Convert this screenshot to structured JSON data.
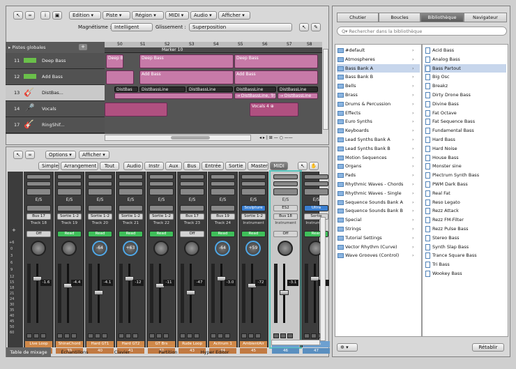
{
  "arrange": {
    "toolbar": {
      "edit": "Edition ▾",
      "track": "Piste ▾",
      "region": "Région ▾",
      "midi": "MIDI ▾",
      "audio": "Audio ▾",
      "view": "Afficher ▾"
    },
    "snap_label": "Magnétisme :",
    "snap_value": "Intelligent",
    "drag_label": "Glissement :",
    "drag_value": "Superposition",
    "global_tracks": "▸ Pistes globales",
    "bars": [
      "50",
      "S1",
      "S2",
      "S3",
      "S4",
      "S5",
      "S6",
      "S7",
      "S8"
    ],
    "marker": "Marker 10",
    "tracks": [
      {
        "num": "11",
        "name": "Deep Bass"
      },
      {
        "num": "12",
        "name": "Add Bass"
      },
      {
        "num": "13",
        "name": "DistBas..."
      },
      {
        "num": "14",
        "name": "Vocals"
      },
      {
        "num": "17",
        "name": "RingShif..."
      }
    ],
    "regions": {
      "deep_a": "Deep B",
      "deep_b": "Deep Bass",
      "deep_c": "Deep Bass",
      "add_b": "Add Bass",
      "add_c": "Add Bass",
      "dist_1": "DistBas",
      "dist_2": "DistBassLine",
      "dist_3": "DistBassLine",
      "dist_4": "DistBassLine",
      "dist_5": "DistBassLine",
      "dist_6": "→ DistBassLine, Tr)",
      "dist_7": "→ DistBassLine",
      "vocals": "Vocals 4 ⊕"
    }
  },
  "mixer": {
    "options": "Options ▾",
    "view": "Afficher ▾",
    "filters": [
      "Simple",
      "Arrangement",
      "Tout",
      "Audio",
      "Instr",
      "Aux",
      "Bus",
      "Entrée",
      "Sortie",
      "Master",
      "MIDI"
    ],
    "scale": [
      "+",
      "+6",
      "0",
      "3",
      "6",
      "9",
      "12",
      "15",
      "18",
      "21",
      "24",
      "30",
      "35",
      "40",
      "45",
      "50",
      "60"
    ],
    "strips": [
      {
        "io": "E/S",
        "slot": "",
        "out": "Bus 17",
        "track": "Track 18",
        "auto": "Off",
        "pan": "",
        "vol": "-1.6",
        "name": "Live Loop",
        "num": "38"
      },
      {
        "io": "E/S",
        "slot": "",
        "out": "Sortie 1-2",
        "track": "Track 19",
        "auto": "Read",
        "pan": "",
        "vol": "-4.4",
        "name": "ShineChord",
        "num": "39"
      },
      {
        "io": "E/S",
        "slot": "",
        "out": "Sortie 1-2",
        "track": "Track 20",
        "auto": "Read",
        "pan": "-64",
        "vol": "-4.1",
        "name": "Hard GT1",
        "num": "40"
      },
      {
        "io": "E/S",
        "slot": "",
        "out": "Sortie 1-2",
        "track": "Track 21",
        "auto": "Read",
        "pan": "+63",
        "vol": "-12",
        "name": "Hard GT2",
        "num": "41"
      },
      {
        "io": "E/S",
        "slot": "",
        "out": "Sortie 1-2",
        "track": "Track 22",
        "auto": "Read",
        "pan": "",
        "vol": "-11",
        "name": "GT Brs",
        "num": "42"
      },
      {
        "io": "E/S",
        "slot": "",
        "out": "Bus 17",
        "track": "Track 23",
        "auto": "Off",
        "pan": "",
        "vol": "-47",
        "name": "Rude Loop",
        "num": "43"
      },
      {
        "io": "E/S",
        "slot": "",
        "out": "Bus 19",
        "track": "Track 24",
        "auto": "Read",
        "pan": "-64",
        "vol": "-3.0",
        "name": "Acitrum 1",
        "num": "44"
      },
      {
        "io": "E/S",
        "slot": "Sculpture",
        "out": "Sortie 1-2",
        "track": "Instrument",
        "auto": "Read",
        "pan": "+59",
        "vol": "-72",
        "name": "AmbientAir",
        "num": "45"
      },
      {
        "io": "E/S",
        "slot": "ES2",
        "out": "Bus 18",
        "track": "Instrument",
        "auto": "Off",
        "pan": "",
        "vol": "-3.1",
        "name": "CrunchBass",
        "num": "46"
      },
      {
        "io": "E/S",
        "slot": "Ultra",
        "out": "Sortie",
        "track": "Instrument",
        "auto": "Read",
        "pan": "",
        "vol": "",
        "name": "Ultra",
        "num": "47"
      }
    ],
    "bottom_tabs": [
      "Table de mixage",
      "Échantillons",
      "Clavier",
      "Partition",
      "Hyper Editor"
    ]
  },
  "browser": {
    "tabs": [
      "Chutier",
      "Boucles",
      "Bibliothèque",
      "Navigateur"
    ],
    "search_placeholder": "Q▾ Rechercher dans la bibliothèque",
    "categories": [
      "#default",
      "Atmospheres",
      "Bass Bank A",
      "Bass Bank B",
      "Bells",
      "Brass",
      "Drums & Percussion",
      "Effects",
      "Euro Synths",
      "Keyboards",
      "Lead Synths Bank A",
      "Lead Synths Bank B",
      "Motion Sequences",
      "Organs",
      "Pads",
      "Rhythmic Waves - Chords",
      "Rhythmic Waves - Single",
      "Sequence Sounds Bank A",
      "Sequence Sounds Bank B",
      "Special",
      "Strings",
      "Tutorial Settings",
      "Vector Rhythm (Curve)",
      "Wave Grooves (Control)"
    ],
    "selected_category": 2,
    "patches": [
      "Acid Bass",
      "Analog Bass",
      "Bass Partout",
      "Big Osc",
      "Breakz",
      "Dirty Drone Bass",
      "Divine Bass",
      "Fat Octave",
      "Fat Sequence Bass",
      "Fundamental Bass",
      "Hard Bass",
      "Hard Noise",
      "House Bass",
      "Monster sine",
      "Plectrum Synth Bass",
      "PWM Dark Bass",
      "Real Fat",
      "Reso Legato",
      "Rezz Attack",
      "Rezz FM-Filter",
      "Rezz Pulse Bass",
      "Stereo Bass",
      "Synth Slap Bass",
      "Trance Square Bass",
      "Tri Bass",
      "Wookey Bass"
    ],
    "selected_patch": 2,
    "gear": "✲ ▾",
    "reset": "Rétablir"
  }
}
